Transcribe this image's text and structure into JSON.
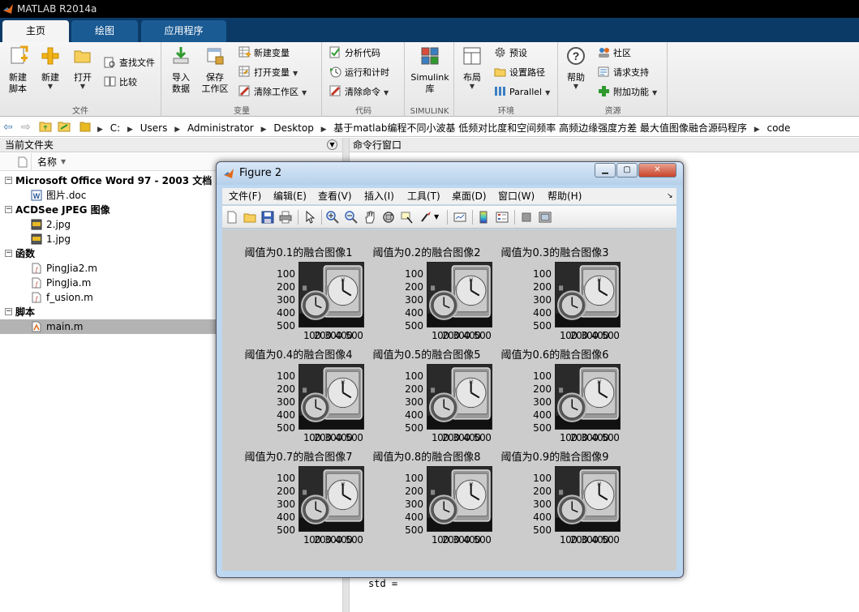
{
  "app": {
    "title": "MATLAB R2014a",
    "tabs": [
      "主页",
      "绘图",
      "应用程序"
    ]
  },
  "ribbon": {
    "file_group": {
      "label": "文件",
      "new_script": [
        "新建",
        "脚本"
      ],
      "new": "新建",
      "open": "打开",
      "find_files": "查找文件",
      "compare": "比较"
    },
    "variable_group": {
      "label": "变量",
      "import": [
        "导入",
        "数据"
      ],
      "save_ws": [
        "保存",
        "工作区"
      ],
      "new_var": "新建变量",
      "open_var": "打开变量",
      "clear_ws": "清除工作区"
    },
    "code_group": {
      "label": "代码",
      "analyze": "分析代码",
      "run_time": "运行和计时",
      "clear_cmd": "清除命令"
    },
    "simulink_group": {
      "label": "SIMULINK",
      "lib": [
        "Simulink",
        "库"
      ]
    },
    "env_group": {
      "label": "环境",
      "layout": "布局",
      "prefs": "预设",
      "set_path": "设置路径",
      "parallel": "Parallel"
    },
    "resources_group": {
      "label": "资源",
      "help": "帮助",
      "community": "社区",
      "support": "请求支持",
      "addons": "附加功能"
    }
  },
  "address": {
    "crumbs": [
      "C:",
      "Users",
      "Administrator",
      "Desktop",
      "基于matlab编程不同小波基 低频对比度和空间频率 高频边缘强度方差 最大值图像融合源码程序",
      "code"
    ]
  },
  "folder_panel": {
    "title": "当前文件夹",
    "column": "名称",
    "groups": [
      {
        "label": "Microsoft Office Word 97 - 2003 文档",
        "files": [
          "图片.doc"
        ]
      },
      {
        "label": "ACDSee JPEG 图像",
        "files": [
          "2.jpg",
          "1.jpg"
        ]
      },
      {
        "label": "函数",
        "files": [
          "PingJia2.m",
          "PingJia.m",
          "f_usion.m"
        ]
      },
      {
        "label": "脚本",
        "files": [
          "main.m"
        ]
      }
    ]
  },
  "command_window": {
    "title": "命令行窗口",
    "std_line": "std ="
  },
  "figure": {
    "title": "Figure 2",
    "menu": [
      "文件(F)",
      "编辑(E)",
      "查看(V)",
      "插入(I)",
      "工具(T)",
      "桌面(D)",
      "窗口(W)",
      "帮助(H)"
    ],
    "subplot_titles": [
      "阈值为0.1的融合图像1",
      "阈值为0.2的融合图像2",
      "阈值为0.3的融合图像3",
      "阈值为0.4的融合图像4",
      "阈值为0.5的融合图像5",
      "阈值为0.6的融合图像6",
      "阈值为0.7的融合图像7",
      "阈值为0.8的融合图像8",
      "阈值为0.9的融合图像9"
    ],
    "y_ticks": [
      "100",
      "200",
      "300",
      "400",
      "500"
    ],
    "x_ticks": [
      "100",
      "200",
      "300",
      "400",
      "500"
    ]
  },
  "colors": {
    "ribbon_tabbar": "#0b3a67",
    "figure_bg": "#cccccc",
    "selected_file": "#b3b3b3"
  }
}
